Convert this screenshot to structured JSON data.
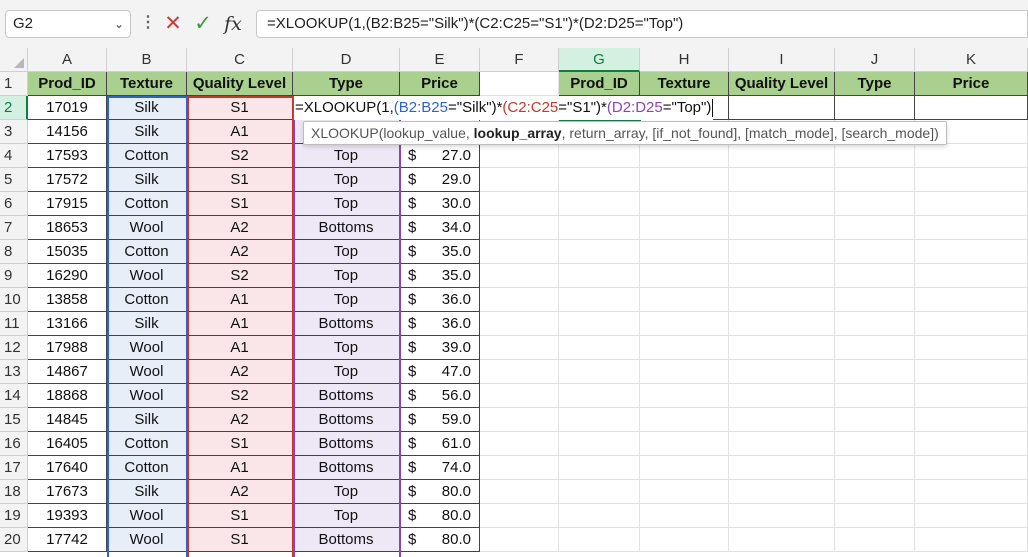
{
  "formula_bar": {
    "name_box": "G2",
    "formula": "=XLOOKUP(1,(B2:B25=\"Silk\")*(C2:C25=\"S1\")*(D2:D25=\"Top\")",
    "cancel_icon": "close-x-icon",
    "enter_icon": "check-icon",
    "fx_label": "fx"
  },
  "columns": [
    "A",
    "B",
    "C",
    "D",
    "E",
    "F",
    "G",
    "H",
    "I",
    "J",
    "K"
  ],
  "selected_column": "G",
  "row_numbers": [
    "1",
    "2",
    "3",
    "4",
    "5",
    "6",
    "7",
    "8",
    "9",
    "10",
    "11",
    "12",
    "13",
    "14",
    "15",
    "16",
    "17",
    "18",
    "19",
    "20"
  ],
  "selected_row": "2",
  "table_headers": {
    "prod_id": "Prod_ID",
    "texture": "Texture",
    "quality": "Quality Level",
    "type": "Type",
    "price": "Price"
  },
  "lookup_headers": {
    "prod_id": "Prod_ID",
    "texture": "Texture",
    "quality": "Quality Level",
    "type": "Type",
    "price": "Price"
  },
  "rows": [
    {
      "id": "17019",
      "texture": "Silk",
      "quality": "S1",
      "type": "",
      "cur": "",
      "price": ""
    },
    {
      "id": "14156",
      "texture": "Silk",
      "quality": "A1",
      "type": "",
      "cur": "",
      "price": ""
    },
    {
      "id": "17593",
      "texture": "Cotton",
      "quality": "S2",
      "type": "Top",
      "cur": "$",
      "price": "27.0"
    },
    {
      "id": "17572",
      "texture": "Silk",
      "quality": "S1",
      "type": "Top",
      "cur": "$",
      "price": "29.0"
    },
    {
      "id": "17915",
      "texture": "Cotton",
      "quality": "S1",
      "type": "Top",
      "cur": "$",
      "price": "30.0"
    },
    {
      "id": "18653",
      "texture": "Wool",
      "quality": "A2",
      "type": "Bottoms",
      "cur": "$",
      "price": "34.0"
    },
    {
      "id": "15035",
      "texture": "Cotton",
      "quality": "A2",
      "type": "Top",
      "cur": "$",
      "price": "35.0"
    },
    {
      "id": "16290",
      "texture": "Wool",
      "quality": "S2",
      "type": "Top",
      "cur": "$",
      "price": "35.0"
    },
    {
      "id": "13858",
      "texture": "Cotton",
      "quality": "A1",
      "type": "Top",
      "cur": "$",
      "price": "36.0"
    },
    {
      "id": "13166",
      "texture": "Silk",
      "quality": "A1",
      "type": "Bottoms",
      "cur": "$",
      "price": "36.0"
    },
    {
      "id": "17988",
      "texture": "Wool",
      "quality": "A1",
      "type": "Top",
      "cur": "$",
      "price": "39.0"
    },
    {
      "id": "14867",
      "texture": "Wool",
      "quality": "A2",
      "type": "Top",
      "cur": "$",
      "price": "47.0"
    },
    {
      "id": "18868",
      "texture": "Wool",
      "quality": "S2",
      "type": "Bottoms",
      "cur": "$",
      "price": "56.0"
    },
    {
      "id": "14845",
      "texture": "Silk",
      "quality": "A2",
      "type": "Bottoms",
      "cur": "$",
      "price": "59.0"
    },
    {
      "id": "16405",
      "texture": "Cotton",
      "quality": "S1",
      "type": "Bottoms",
      "cur": "$",
      "price": "61.0"
    },
    {
      "id": "17640",
      "texture": "Cotton",
      "quality": "A1",
      "type": "Bottoms",
      "cur": "$",
      "price": "74.0"
    },
    {
      "id": "17673",
      "texture": "Silk",
      "quality": "A2",
      "type": "Top",
      "cur": "$",
      "price": "80.0"
    },
    {
      "id": "19393",
      "texture": "Wool",
      "quality": "S1",
      "type": "Top",
      "cur": "$",
      "price": "80.0"
    },
    {
      "id": "17742",
      "texture": "Wool",
      "quality": "S1",
      "type": "Bottoms",
      "cur": "$",
      "price": "80.0"
    }
  ],
  "in_cell_formula": {
    "prefix": "=XLOOKUP(1,",
    "ref_b": "(B2:B25",
    "crit_b": "=\"Silk\")*",
    "ref_c": "(C2:C25",
    "crit_c": "=\"S1\")*",
    "ref_d": "(D2:D25",
    "crit_d": "=\"Top\")"
  },
  "tooltip": {
    "func": "XLOOKUP(",
    "arg1": "lookup_value, ",
    "arg2_bold": "lookup_array",
    "rest": ", return_array, [if_not_found], [match_mode], [search_mode])"
  },
  "colors": {
    "header_fill": "#a9d08e",
    "ref_b": "#2e64c8",
    "ref_c": "#c0392b",
    "ref_d": "#8e44ad",
    "selection": "#107c41"
  }
}
